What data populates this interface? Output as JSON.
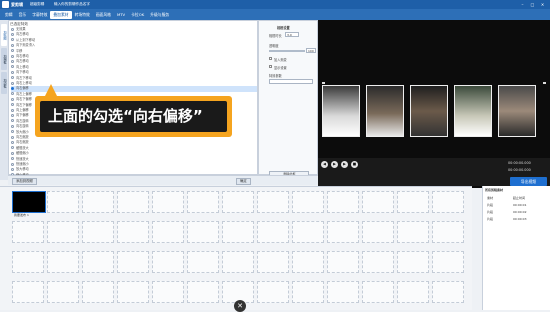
{
  "app": {
    "name": "爱剪辑",
    "subtitle": "超级剪辑",
    "window_title": "输入你的剪辑作品名字"
  },
  "menu": [
    "剪辑",
    "音乐",
    "字幕特效",
    "叠加素材",
    "转场特效",
    "画面风格",
    "MTV",
    "卡拉OK",
    "升级与服务"
  ],
  "active_menu_index": 3,
  "left_tabs": [
    "加贴图",
    "加相框",
    "加边框"
  ],
  "list_header": "已选定特效",
  "list_items": [
    "无效果",
    "向左移动",
    "从上到下移动",
    "向下渐变滑入",
    "平移",
    "向右移动",
    "向左移动",
    "向上移动",
    "向下移动",
    "向左下移动",
    "向右上移动",
    "向右偏移",
    "向左上偏移",
    "向右下偏移",
    "向左下偏移",
    "向上偏移",
    "向下偏移",
    "向左旋转",
    "向右旋转",
    "放大缩小",
    "向左缩放",
    "向右缩放",
    "缓慢放大",
    "缓慢缩小",
    "快速放大",
    "快速缩小",
    "放大移动",
    "缩小移动"
  ],
  "selected_index": 11,
  "settings": {
    "title": "相框设置",
    "duration_label": "相框时长",
    "duration_value": "3.0",
    "opacity_label": "透明度",
    "opacity_value": "100",
    "check1_label": "加入渐变",
    "check2_label": "显示设置",
    "effect_label": "特效参数",
    "apply_btn": "确定",
    "reset_btn": "删除此框"
  },
  "callout": "上面的勾选“向右偏移”",
  "bottom": {
    "add_btn": "添加到视频",
    "ok_btn": "确定",
    "export_btn": "导出视频"
  },
  "transport": {
    "time_current": "00:00:00.000",
    "time_total": "00:00:00.000"
  },
  "timeline": {
    "clip_label": "我要发布 1"
  },
  "right_panel": {
    "header": "所有剪辑素材",
    "col1": "素材",
    "col2": "起止时间",
    "rows": [
      [
        "片段",
        "00:00:01"
      ],
      [
        "片段",
        "00:00:02"
      ],
      [
        "片段",
        "00:00:03"
      ]
    ]
  },
  "colors": {
    "accent": "#1e5fa8",
    "callout": "#f5a41f",
    "selected": "#cfe3fb"
  }
}
